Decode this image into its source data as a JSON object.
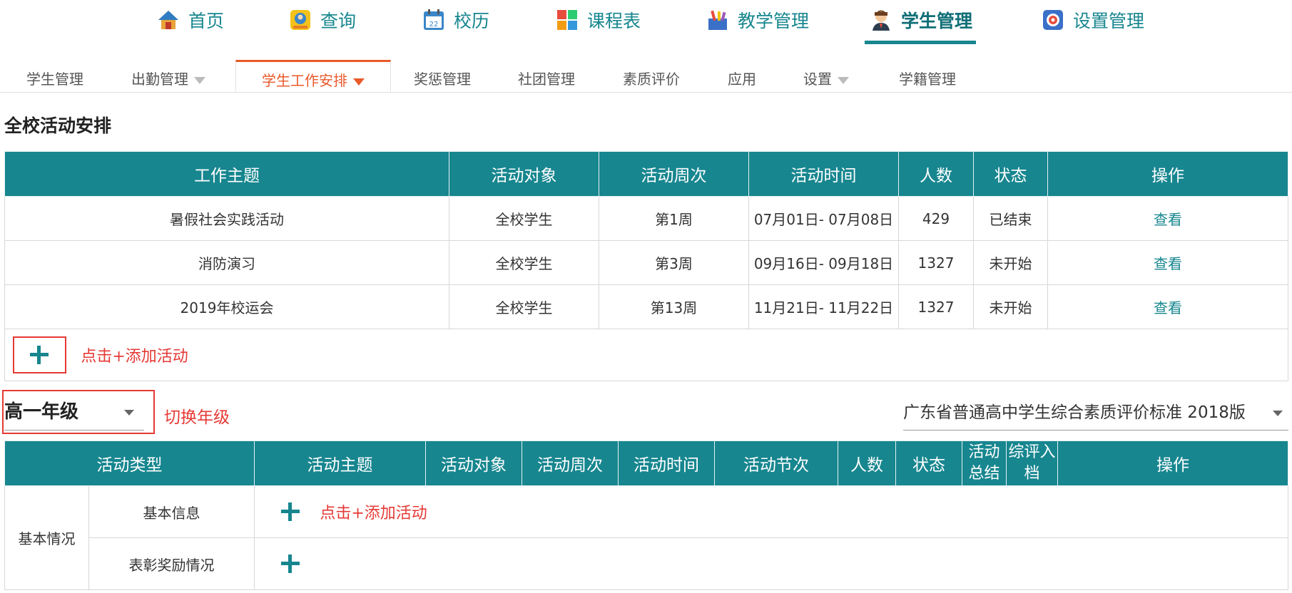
{
  "topnav": {
    "items": [
      {
        "label": "首页",
        "icon": "home-icon"
      },
      {
        "label": "查询",
        "icon": "search-person-icon"
      },
      {
        "label": "校历",
        "icon": "calendar-icon"
      },
      {
        "label": "课程表",
        "icon": "timetable-icon"
      },
      {
        "label": "教学管理",
        "icon": "teaching-icon"
      },
      {
        "label": "学生管理",
        "icon": "student-icon",
        "active": true
      },
      {
        "label": "设置管理",
        "icon": "settings-icon"
      }
    ]
  },
  "subnav": {
    "tabs": [
      {
        "label": "学生管理"
      },
      {
        "label": "出勤管理",
        "dropdown": true
      },
      {
        "label": "学生工作安排",
        "dropdown": true,
        "active": true
      },
      {
        "label": "奖惩管理"
      },
      {
        "label": "社团管理"
      },
      {
        "label": "素质评价"
      },
      {
        "label": "应用"
      },
      {
        "label": "设置",
        "dropdown": true
      },
      {
        "label": "学籍管理"
      }
    ]
  },
  "school": {
    "title": "全校活动安排",
    "headers": [
      "工作主题",
      "活动对象",
      "活动周次",
      "活动时间",
      "人数",
      "状态",
      "操作"
    ],
    "rows": [
      {
        "topic": "暑假社会实践活动",
        "target": "全校学生",
        "week": "第1周",
        "time": "07月01日- 07月08日",
        "count": "429",
        "status": "已结束",
        "action": "查看"
      },
      {
        "topic": "消防演习",
        "target": "全校学生",
        "week": "第3周",
        "time": "09月16日- 09月18日",
        "count": "1327",
        "status": "未开始",
        "action": "查看"
      },
      {
        "topic": "2019年校运会",
        "target": "全校学生",
        "week": "第13周",
        "time": "11月21日- 11月22日",
        "count": "1327",
        "status": "未开始",
        "action": "查看"
      }
    ],
    "add_hint": "点击+添加活动"
  },
  "grade": {
    "selected": "高一年级",
    "hint": "切换年级",
    "standard": "广东省普通高中学生综合素质评价标准 2018版",
    "headers": {
      "type": "活动类型",
      "topic": "活动主题",
      "target": "活动对象",
      "week": "活动周次",
      "time": "活动时间",
      "session": "活动节次",
      "count": "人数",
      "status": "状态",
      "summary": "活动总结",
      "archive": "综评入档",
      "action": "操作"
    },
    "category": "基本情况",
    "subcategories": [
      "基本信息",
      "表彰奖励情况"
    ],
    "add_hint": "点击+添加活动"
  },
  "colors": {
    "accent": "#17868f",
    "active_tab": "#ea5a2a",
    "hint_red": "#e53935"
  }
}
